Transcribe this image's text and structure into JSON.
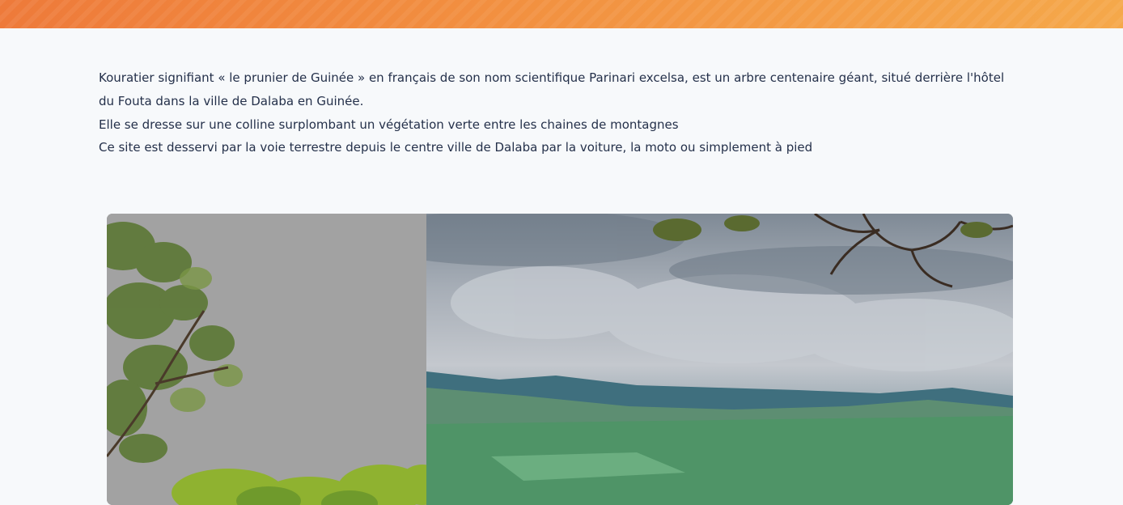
{
  "header": {
    "accent_colors": [
      "#ee7a3a",
      "#f5a84a"
    ]
  },
  "description": {
    "paragraph_1": "Kouratier signifiant « le prunier de Guinée » en français de son nom scientifique Parinari excelsa, est un arbre centenaire géant, situé derrière l'hôtel du Fouta dans la ville de Dalaba en Guinée.",
    "paragraph_2": "Elle se dresse sur une colline surplombant un végétation verte entre les chaines de montagnes",
    "paragraph_3": "Ce site est desservi par la voie terrestre depuis le centre ville de Dalaba par la voiture, la moto ou simplement à pied"
  },
  "gallery": {
    "images": [
      {
        "name": "tree-photo"
      },
      {
        "name": "valley-landscape-photo"
      }
    ]
  }
}
